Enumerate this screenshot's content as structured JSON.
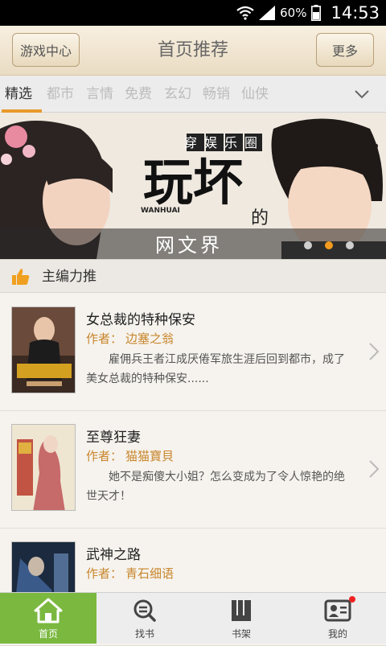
{
  "status": {
    "battery_pct": "60%",
    "time": "14:53"
  },
  "header": {
    "left_button": "游戏中心",
    "title": "首页推荐",
    "right_button": "更多"
  },
  "tabs": [
    {
      "label": "精选"
    },
    {
      "label": "都市"
    },
    {
      "label": "言情"
    },
    {
      "label": "免费"
    },
    {
      "label": "玄幻"
    },
    {
      "label": "畅销"
    },
    {
      "label": "仙侠"
    }
  ],
  "banner": {
    "line1": "穿娱乐圈",
    "main": "玩坏",
    "de": "的",
    "sub": "网文界",
    "latin": "WANHUAI"
  },
  "section": {
    "label": "主编力推"
  },
  "books": [
    {
      "title": "女总裁的特种保安",
      "author_label": "作者：",
      "author": "边塞之翁",
      "desc": "雇佣兵王者江成厌倦军旅生涯后回到都市，成了美女总裁的特种保安......"
    },
    {
      "title": "至尊狂妻",
      "author_label": "作者：",
      "author": "猫猫寶貝",
      "desc": "她不是痴傻大小姐？怎么变成为了令人惊艳的绝世天才！"
    },
    {
      "title": "武神之路",
      "author_label": "作者：",
      "author": "青石细语",
      "desc": ""
    }
  ],
  "nav": [
    {
      "label": "首页"
    },
    {
      "label": "找书"
    },
    {
      "label": "书架"
    },
    {
      "label": "我的"
    }
  ],
  "colors": {
    "accent": "#e89a2a",
    "nav_active": "#7bb840",
    "author": "#c8862c"
  }
}
